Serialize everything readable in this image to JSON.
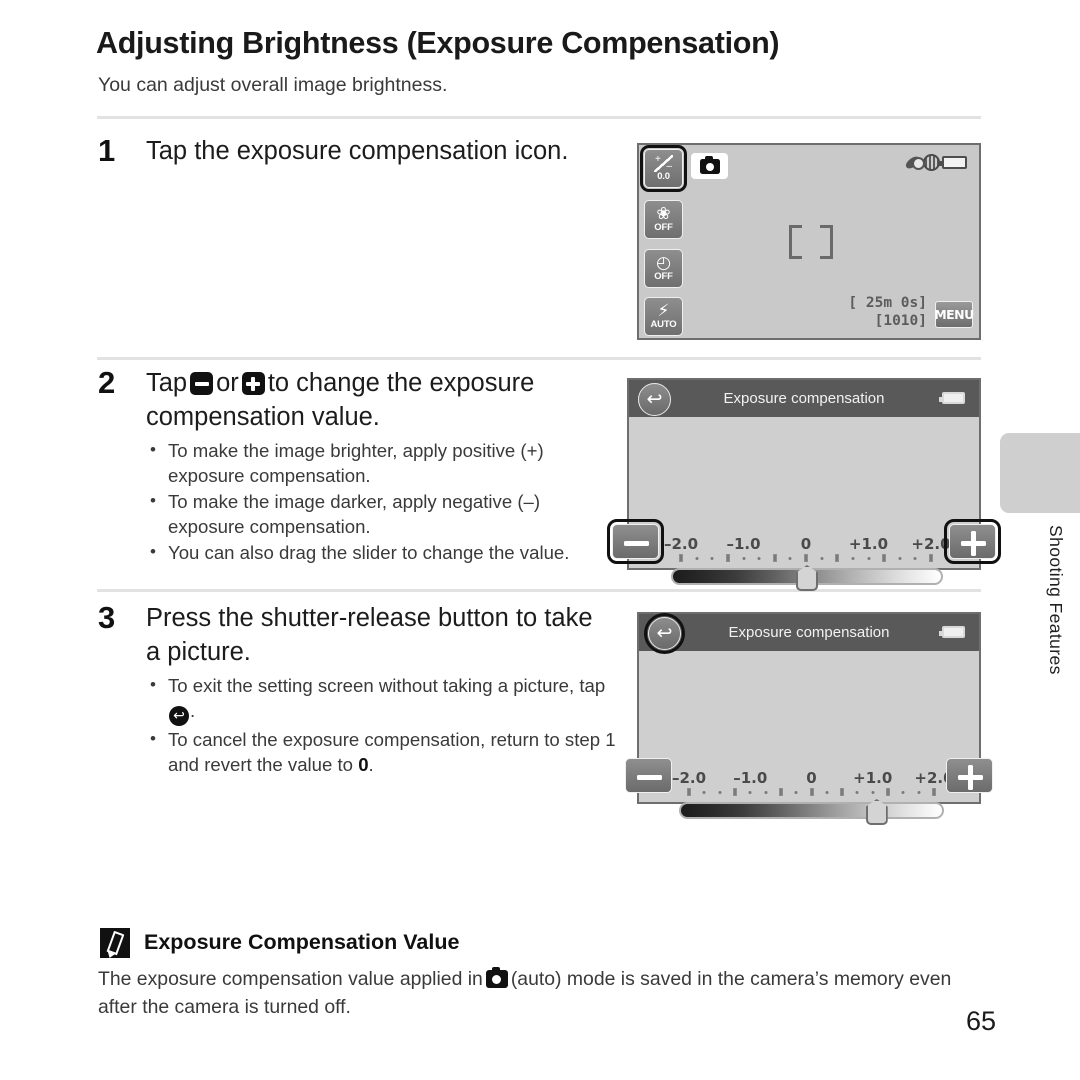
{
  "document": {
    "title": "Adjusting Brightness (Exposure Compensation)",
    "subtitle": "You can adjust overall image brightness.",
    "page_number": "65",
    "side_tab_label": "Shooting Features"
  },
  "steps": [
    {
      "number": "1",
      "heading": "Tap the exposure compensation icon.",
      "bullets": []
    },
    {
      "number": "2",
      "heading_part_1": "Tap",
      "heading_part_2": "or",
      "heading_part_3": "to change the exposure compensation value.",
      "number_label": "2",
      "bullets": [
        "To make the image brighter, apply positive (+) exposure compensation.",
        "To make the image darker, apply negative (–) exposure compensation.",
        "You can also drag the slider to change the value."
      ]
    },
    {
      "number": "3",
      "heading": "Press the shutter-release button to take a picture.",
      "bullet_1_part_1": "To exit the setting screen without taking a picture, tap",
      "bullet_1_part_2": ".",
      "bullet_2_part_1": "To cancel the exposure compensation, return to step 1 and revert the value to",
      "bullet_2_value": "0",
      "bullet_2_part_2": "."
    }
  ],
  "live_view_screen": {
    "icons": [
      {
        "name": "exposure-compensation",
        "value": "0.0",
        "selected": true
      },
      {
        "name": "macro-mode",
        "value": "OFF",
        "glyph": "❀",
        "selected": false
      },
      {
        "name": "self-timer",
        "value": "OFF",
        "glyph": "◴",
        "selected": false
      },
      {
        "name": "flash-mode",
        "value": "AUTO",
        "glyph": "⚡",
        "selected": false
      }
    ],
    "mode_badge": "camera-auto-mode",
    "time_remaining": "[ 25m  0s]",
    "shots_remaining": "[1010]",
    "menu_label": "MENU"
  },
  "exposure_screen_step2": {
    "title": "Exposure compensation",
    "back_button_selected": false,
    "minus_button_selected": true,
    "plus_button_selected": true,
    "scale_labels": [
      "–2.0",
      "–1.0",
      "0",
      "+1.0",
      "+2.0"
    ],
    "current_value": "0",
    "thumb_position_percent": 50
  },
  "exposure_screen_step3": {
    "title": "Exposure compensation",
    "back_button_selected": true,
    "minus_button_selected": false,
    "plus_button_selected": false,
    "scale_labels": [
      "–2.0",
      "–1.0",
      "0",
      "+1.0",
      "+2.0"
    ],
    "current_value": "+1.0",
    "thumb_position_percent": 75
  },
  "note": {
    "title": "Exposure Compensation Value",
    "body_part_1": "The exposure compensation value applied in",
    "body_part_2": "(auto) mode is saved in the camera’s memory even after the camera is turned off."
  },
  "colors": {
    "screen_bg": "#c9c9c9",
    "screen_border": "#6e6e6e",
    "title_bar": "#595959",
    "highlight": "#111111",
    "rule": "#e2e2e2",
    "side_tab": "#cfcfcf"
  }
}
